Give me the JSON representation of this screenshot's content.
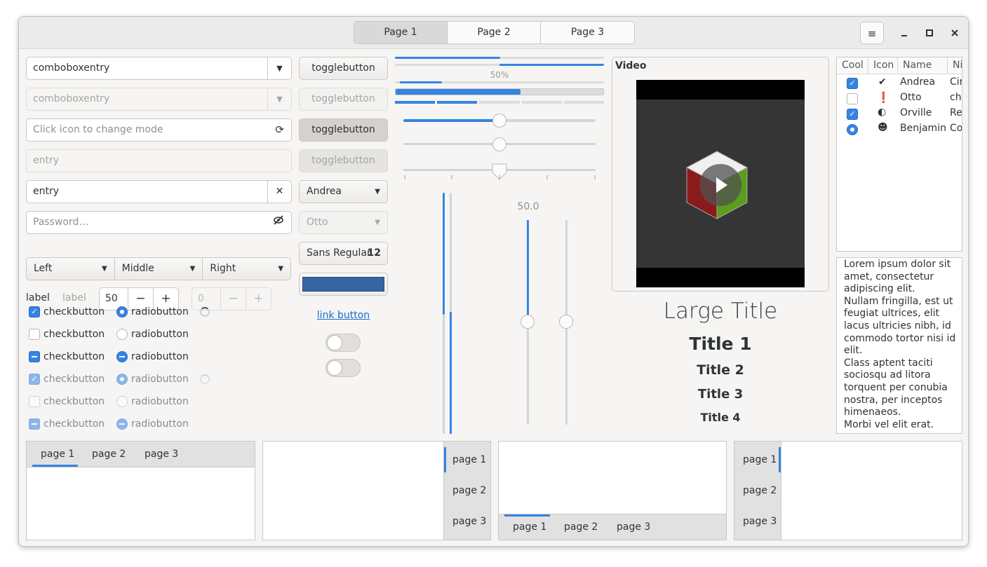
{
  "header": {
    "tabs": [
      "Page 1",
      "Page 2",
      "Page 3"
    ],
    "active_tab": 0,
    "menu_icon": "hamburger-icon",
    "minimize_icon": "minimize-icon",
    "maximize_icon": "maximize-icon",
    "close_icon": "close-icon"
  },
  "left": {
    "comboboxentry_1": "comboboxentry",
    "comboboxentry_2": "comboboxentry",
    "icon_entry_placeholder": "Click icon to change mode",
    "entry_disabled_placeholder": "entry",
    "entry_value": "entry",
    "password_placeholder": "Password…",
    "segmented": [
      "Left",
      "Middle",
      "Right"
    ],
    "label_1": "label",
    "label_2": "label",
    "spin_value": "50",
    "spin_disabled_value": "0",
    "spin_minus": "−",
    "spin_plus": "+",
    "checks": [
      "checkbutton",
      "checkbutton",
      "checkbutton",
      "checkbutton",
      "checkbutton",
      "checkbutton"
    ],
    "radios": [
      "radiobutton",
      "radiobutton",
      "radiobutton",
      "radiobutton",
      "radiobutton",
      "radiobutton"
    ]
  },
  "middle": {
    "togglebuttons": [
      "togglebutton",
      "togglebutton",
      "togglebutton",
      "togglebutton"
    ],
    "combo_1": "Andrea",
    "combo_2": "Otto",
    "font_button_name": "Sans Regular",
    "font_button_size": "12",
    "color_button": "#3465a4",
    "link_button": "link button",
    "switch_1_on": false,
    "switch_2_on": false
  },
  "sliders": {
    "progress_label": "50%",
    "progress_fraction": 0.6,
    "hscale_values": [
      0.5,
      0.5,
      0.5
    ],
    "vscale_label": "50.0",
    "vscale_values": [
      0.5,
      0.5
    ]
  },
  "video": {
    "title": "Video",
    "play_icon": "play-icon"
  },
  "titles": {
    "large": "Large Title",
    "t1": "Title 1",
    "t2": "Title 2",
    "t3": "Title 3",
    "t4": "Title 4"
  },
  "tree": {
    "columns": [
      "Cool",
      "Icon",
      "Name",
      "Ni"
    ],
    "rows": [
      {
        "cool": "checked",
        "icon": "emblem-ok-icon",
        "name": "Andrea",
        "nick": "Cir"
      },
      {
        "cool": "unchecked",
        "icon": "exclamation-icon",
        "name": "Otto",
        "nick": "cha"
      },
      {
        "cool": "checked",
        "icon": "moon-phase-icon",
        "name": "Orville",
        "nick": "Re"
      },
      {
        "cool": "radio",
        "icon": "monkey-icon",
        "name": "Benjamin",
        "nick": "Co"
      }
    ]
  },
  "text_view": {
    "paragraphs": [
      "Lorem ipsum dolor sit amet, consectetur adipiscing elit.",
      "Nullam fringilla, est ut feugiat ultrices, elit lacus ultricies nibh, id commodo tortor nisi id elit.",
      "Class aptent taciti sociosqu ad litora torquent per conubia nostra, per inceptos himenaeos.",
      "Morbi vel elit erat."
    ]
  },
  "notebooks": [
    {
      "tabs": [
        "page 1",
        "page 2",
        "page 3"
      ]
    },
    {
      "tabs": [
        "page 1",
        "page 2",
        "page 3"
      ]
    },
    {
      "tabs": [
        "page 1",
        "page 2",
        "page 3"
      ]
    },
    {
      "tabs": [
        "page 1",
        "page 2",
        "page 3"
      ]
    }
  ],
  "colors": {
    "accent": "#3584e4",
    "window_bg": "#f6f5f4",
    "header_bg": "#ebebeb"
  }
}
